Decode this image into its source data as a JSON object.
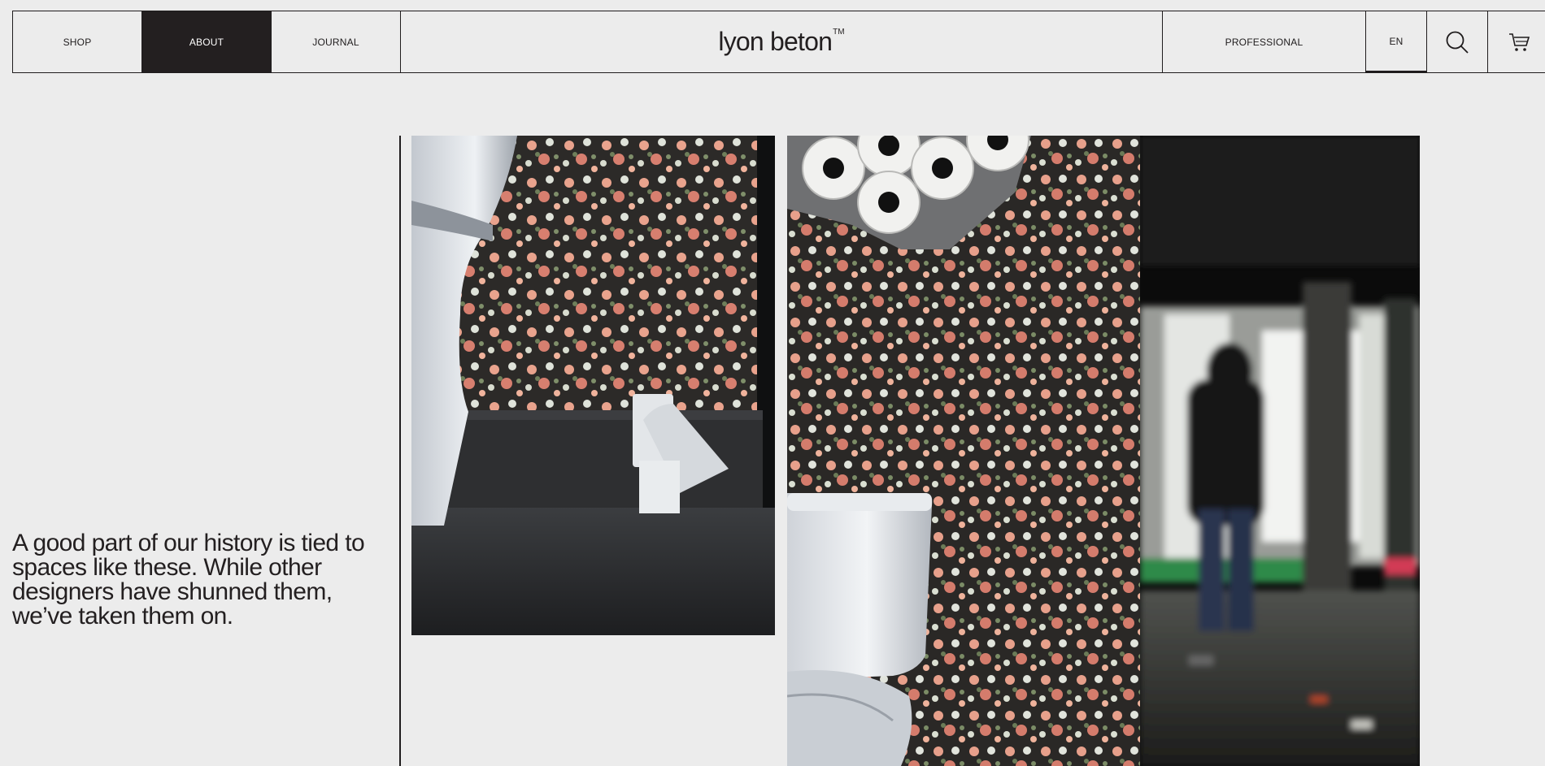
{
  "nav": {
    "shop": "SHOP",
    "about": "ABOUT",
    "journal": "JOURNAL",
    "professional": "PROFESSIONAL",
    "lang": "EN"
  },
  "logo": {
    "name": "lyon beton",
    "tm": "TM"
  },
  "icons": {
    "search": "search-icon",
    "cart": "cart-icon"
  },
  "colors": {
    "accent": "#231f20",
    "background": "#ececec"
  },
  "tagline": "A good part of our history is tied to spaces like these. While other designers have shunned them, we’ve taken them on."
}
